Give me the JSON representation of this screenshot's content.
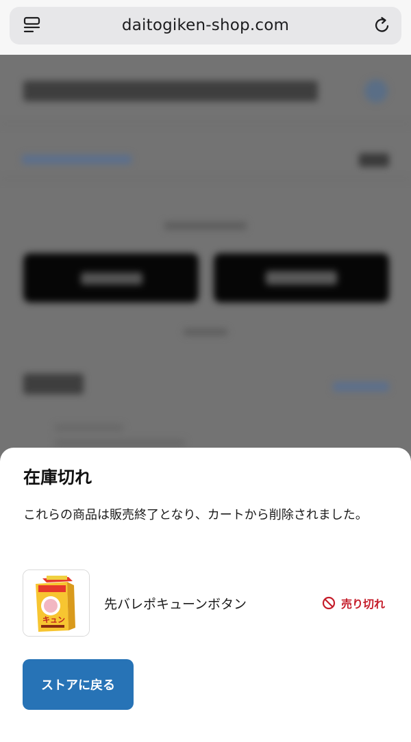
{
  "browser": {
    "url": "daitogiken-shop.com",
    "icons": {
      "menu": "tab-menu-icon",
      "reload": "reload-icon"
    }
  },
  "modal": {
    "title": "在庫切れ",
    "message": "これらの商品は販売終了となり、カートから削除されました。",
    "item": {
      "name": "先バレポキューンボタン",
      "status": "売り切れ",
      "status_icon": "prohibited-icon"
    },
    "back_button": "ストアに戻る"
  },
  "colors": {
    "accent": "#2773b6",
    "soldout": "#c51d2a",
    "overlay": "#737373"
  }
}
